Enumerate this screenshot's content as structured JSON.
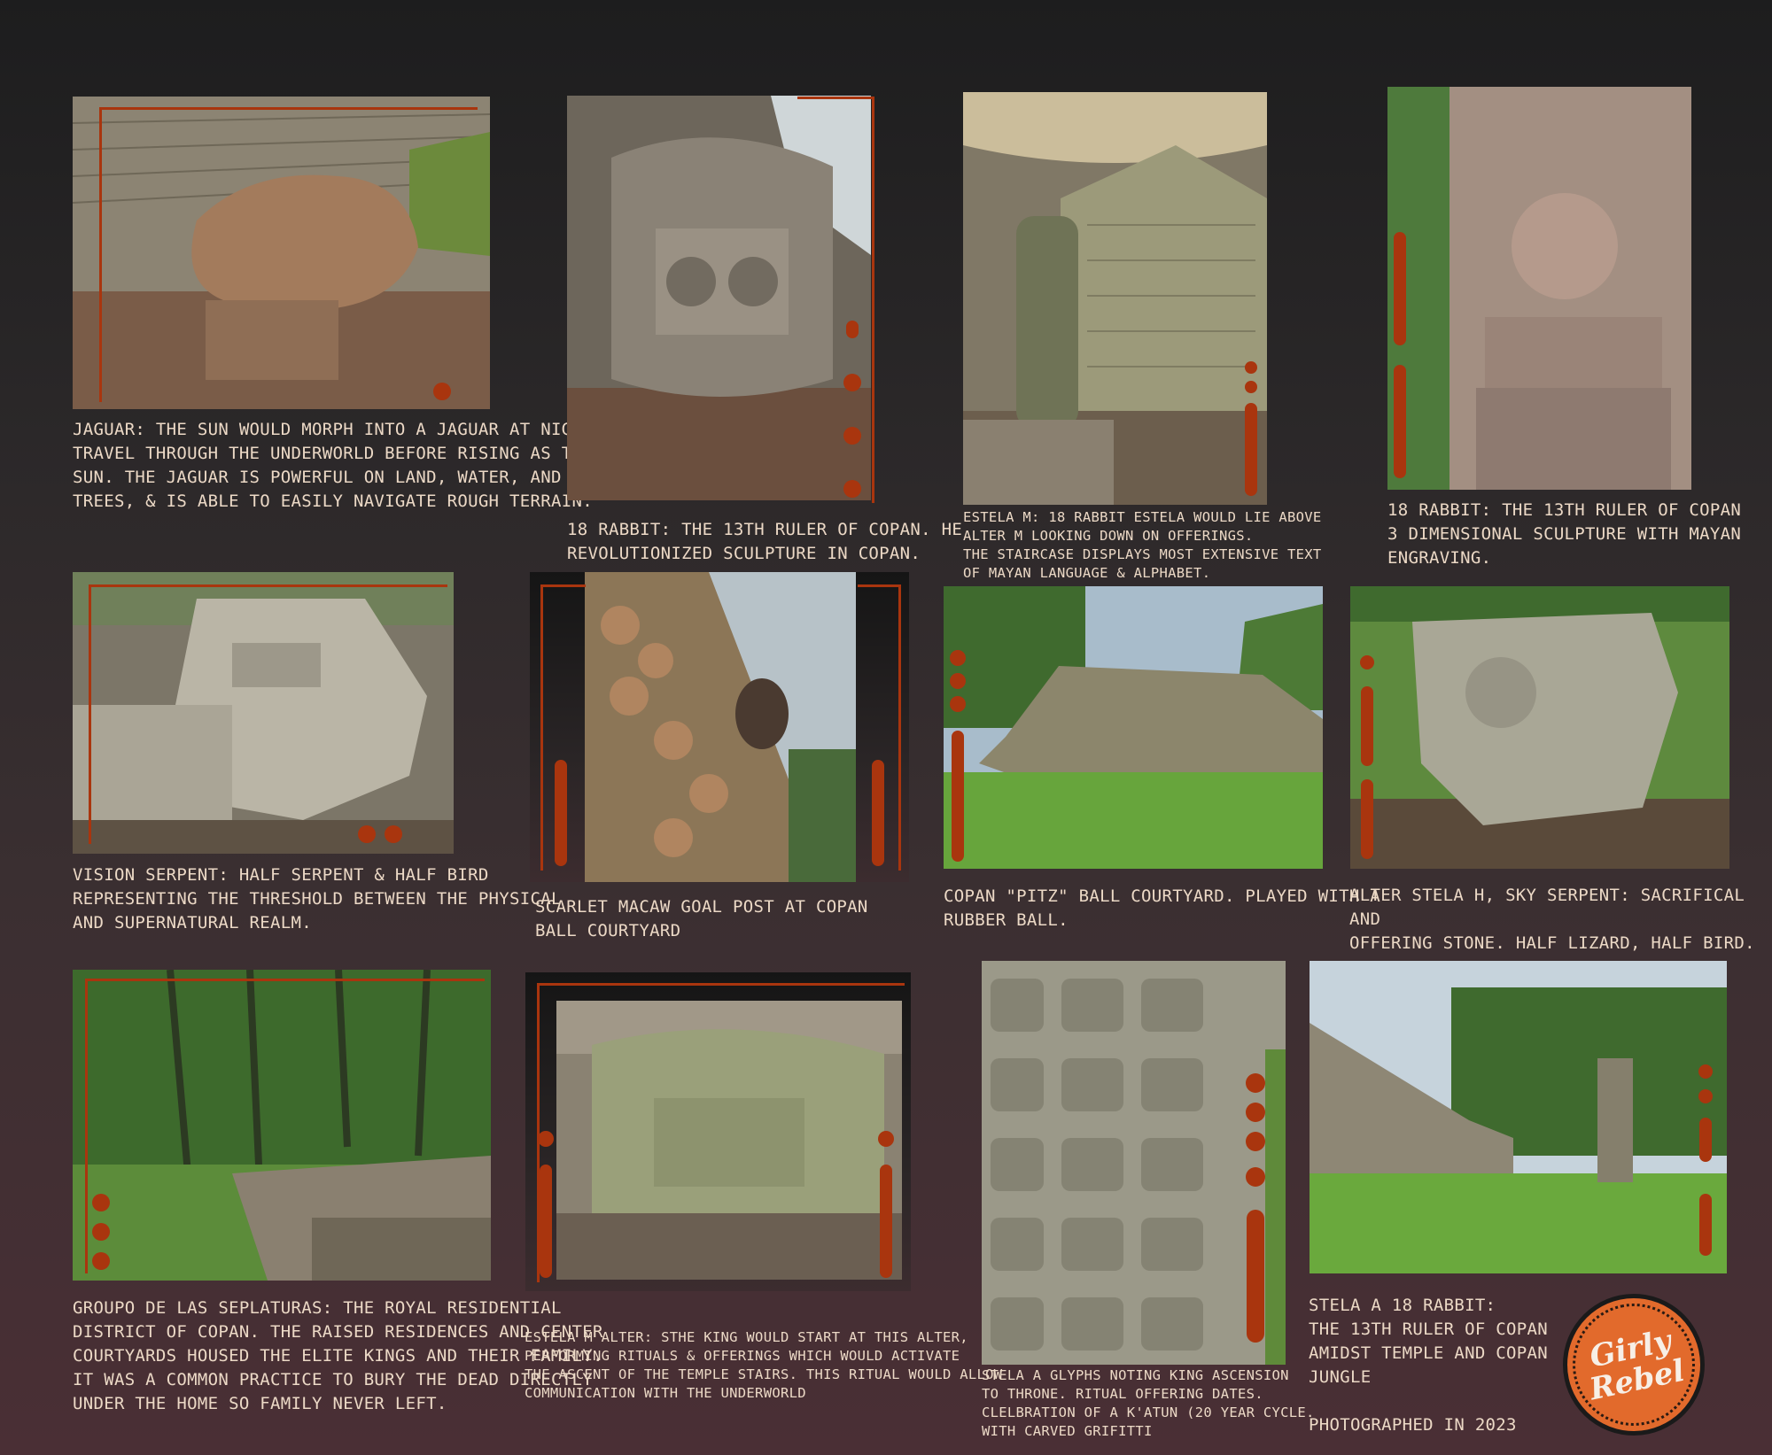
{
  "captions": {
    "jaguar": "JAGUAR: THE SUN WOULD MORPH INTO A JAGUAR AT NIGHT,\nTRAVEL THROUGH THE UNDERWORLD BEFORE RISING AS THE\nSUN. THE JAGUAR IS POWERFUL ON LAND, WATER, AND IN\nTREES, & IS ABLE TO EASILY NAVIGATE ROUGH TERRAIN.",
    "rabbit_head": "18 RABBIT: THE 13TH RULER OF COPAN. HE\nREVOLUTIONIZED SCULPTURE IN COPAN.",
    "estela_m": "ESTELA M:  18 RABBIT ESTELA WOULD LIE ABOVE\nALTER M LOOKING DOWN ON OFFERINGS.\nTHE STAIRCASE DISPLAYS MOST EXTENSIVE TEXT\nOF MAYAN LANGUAGE & ALPHABET.",
    "rabbit_stela": "18 RABBIT: THE 13TH RULER OF COPAN\n3 DIMENSIONAL SCULPTURE WITH MAYAN\nENGRAVING.",
    "vision_serpent": "VISION SERPENT: HALF SERPENT & HALF BIRD\nREPRESENTING THE THRESHOLD BETWEEN THE PHYSICAL\nAND SUPERNATURAL REALM.",
    "macaw": "SCARLET MACAW GOAL POST AT COPAN\nBALL COURTYARD",
    "ball_court": "COPAN \"PITZ\" BALL COURTYARD. PLAYED WITH A\nRUBBER BALL.",
    "alter_h": "ALTER STELA H, SKY SERPENT: SACRIFICAL AND\nOFFERING STONE. HALF LIZARD, HALF BIRD.",
    "sepulturas": "GROUPO DE LAS SEPLATURAS: THE ROYAL RESIDENTIAL\nDISTRICT OF COPAN. THE RAISED RESIDENCES AND CENTER\nCOURTYARDS HOUSED THE ELITE KINGS AND THEIR FAMILY.\nIT WAS A COMMON PRACTICE TO BURY THE DEAD DIRECTLY\nUNDER THE HOME SO FAMILY NEVER LEFT.",
    "estela_m_alter": "ESTELA M ALTER: STHE KING WOULD START AT THIS ALTER,\nPERFORMING RITUALS & OFFERINGS WHICH WOULD ACTIVATE\nTHE ASCENT OF THE TEMPLE STAIRS. THIS RITUAL WOULD ALLOW\nCOMMUNICATION WITH THE UNDERWORLD",
    "glyphs": "STELA A GLYPHS NOTING KING ASCENSION\nTO THRONE. RITUAL OFFERING DATES.\nCLELBRATION OF A K'ATUN (20 YEAR CYCLE.\nWITH CARVED GRIFITTI",
    "stela_a": "STELA A 18 RABBIT:\nTHE 13TH RULER OF COPAN\nAMIDST TEMPLE AND COPAN\nJUNGLE\n\nPHOTOGRAPHED IN 2023"
  },
  "logo": {
    "line1": "Girly",
    "line2": "Rebel"
  },
  "colors": {
    "accent": "#a9350e",
    "caption": "#ecd9c6",
    "logo": "#e26a2c"
  }
}
